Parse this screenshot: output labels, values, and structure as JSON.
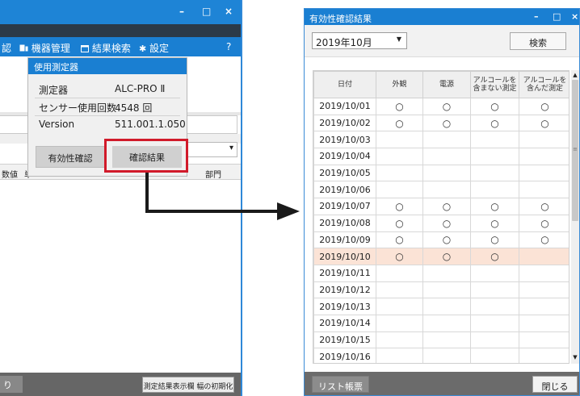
{
  "left_window": {
    "window_controls": {
      "minimize": "–",
      "maximize": "□",
      "close": "×"
    },
    "menu": {
      "partial_item": "認",
      "device_mgmt_icon": "device-icon",
      "device_mgmt": "機器管理",
      "result_search_icon": "calendar-icon",
      "result_search": "結果検索",
      "settings_icon": "gear-icon",
      "settings": "設定",
      "help": "?"
    },
    "table_header": {
      "col1": "数値",
      "col2": "単",
      "col_dept": "部門"
    },
    "bottom": {
      "left_button": "り",
      "reset_button": "測定結果表示欄 幅の初期化"
    }
  },
  "popup": {
    "title": "使用測定器",
    "rows": [
      {
        "label": "測定器",
        "value": "ALC-PRO Ⅱ"
      },
      {
        "label": "センサー使用回数",
        "value": "4548 回"
      },
      {
        "label": "Version",
        "value": "511.001.1.050"
      }
    ],
    "validity_button": "有効性確認",
    "result_button": "確認結果"
  },
  "right_window": {
    "title": "有効性確認結果",
    "window_controls": {
      "minimize": "–",
      "maximize": "□",
      "close": "×"
    },
    "month_select": "2019年10月",
    "month_select_icon": "triangle-down-icon",
    "search_button": "検索",
    "columns": [
      "日付",
      "外観",
      "電源",
      "アルコールを\n含まない測定",
      "アルコールを\n含んだ測定"
    ],
    "mark_symbol": "○",
    "rows": [
      {
        "date": "2019/10/01",
        "marks": [
          true,
          true,
          true,
          true
        ]
      },
      {
        "date": "2019/10/02",
        "marks": [
          true,
          true,
          true,
          true
        ]
      },
      {
        "date": "2019/10/03",
        "marks": [
          false,
          false,
          false,
          false
        ]
      },
      {
        "date": "2019/10/04",
        "marks": [
          false,
          false,
          false,
          false
        ]
      },
      {
        "date": "2019/10/05",
        "marks": [
          false,
          false,
          false,
          false
        ]
      },
      {
        "date": "2019/10/06",
        "marks": [
          false,
          false,
          false,
          false
        ]
      },
      {
        "date": "2019/10/07",
        "marks": [
          true,
          true,
          true,
          true
        ]
      },
      {
        "date": "2019/10/08",
        "marks": [
          true,
          true,
          true,
          true
        ]
      },
      {
        "date": "2019/10/09",
        "marks": [
          true,
          true,
          true,
          true
        ]
      },
      {
        "date": "2019/10/10",
        "marks": [
          true,
          true,
          true,
          false
        ],
        "highlight": true
      },
      {
        "date": "2019/10/11",
        "marks": [
          false,
          false,
          false,
          false
        ]
      },
      {
        "date": "2019/10/12",
        "marks": [
          false,
          false,
          false,
          false
        ]
      },
      {
        "date": "2019/10/13",
        "marks": [
          false,
          false,
          false,
          false
        ]
      },
      {
        "date": "2019/10/14",
        "marks": [
          false,
          false,
          false,
          false
        ]
      },
      {
        "date": "2019/10/15",
        "marks": [
          false,
          false,
          false,
          false
        ]
      },
      {
        "date": "2019/10/16",
        "marks": [
          false,
          false,
          false,
          false
        ]
      }
    ],
    "list_button": "リスト帳票",
    "close_button": "閉じる"
  },
  "colors": {
    "title_blue": "#1a7fd2",
    "highlight_red": "#d11a2a",
    "row_highlight": "#fbe3d6",
    "footer_gray": "#6b6b6b"
  }
}
